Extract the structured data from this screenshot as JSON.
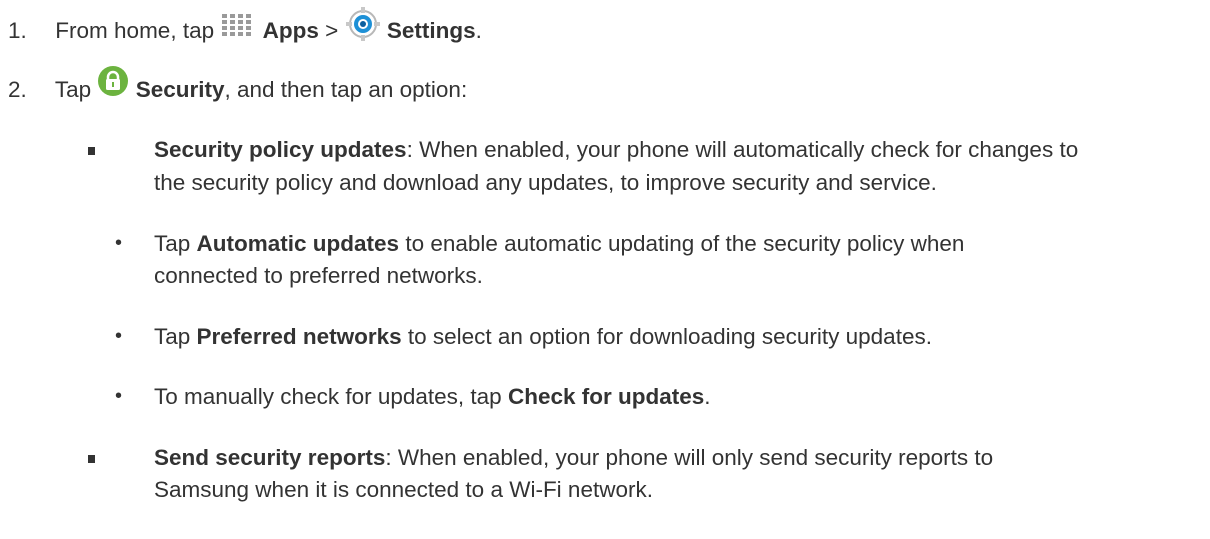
{
  "steps": [
    {
      "number": "1.",
      "text_prefix": "From home, tap",
      "apps_label": "Apps",
      "sep": ">",
      "settings_label": "Settings",
      "text_suffix": "."
    },
    {
      "number": "2.",
      "text_prefix": "Tap",
      "security_label": "Security",
      "text_suffix": ", and then tap an option:"
    }
  ],
  "options": [
    {
      "title": "Security policy updates",
      "line1": ": When enabled, your phone will automatically check for changes to",
      "line2": "the security policy and download any updates, to improve security and service.",
      "subitems": [
        {
          "pre": "Tap ",
          "bold": "Automatic updates",
          "post": " to enable automatic updating of the security policy when",
          "line2": "connected to preferred networks."
        },
        {
          "pre": "Tap ",
          "bold": "Preferred networks",
          "post": " to select an option for downloading security updates."
        },
        {
          "pre": "To manually check for updates, tap ",
          "bold": "Check for updates",
          "post": "."
        }
      ]
    },
    {
      "title": "Send security reports",
      "line1": ": When enabled, your phone will only send security reports to",
      "line2": "Samsung when it is connected to a Wi-Fi network."
    }
  ],
  "icons": {
    "apps": "apps-grid-icon",
    "settings": "settings-gear-icon",
    "security": "lock-icon"
  },
  "colors": {
    "text": "#333333",
    "security_green": "#6cb33f",
    "settings_blue": "#1e90d6"
  }
}
